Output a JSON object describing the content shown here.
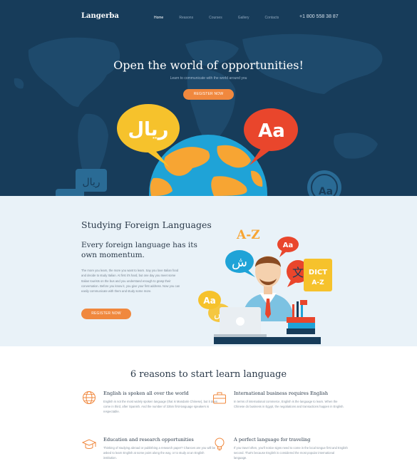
{
  "brand": {
    "name": "Langerba"
  },
  "nav": {
    "items": [
      {
        "label": "Home",
        "active": true
      },
      {
        "label": "Reasons",
        "active": false
      },
      {
        "label": "Courses",
        "active": false
      },
      {
        "label": "Gallery",
        "active": false
      },
      {
        "label": "Contacts",
        "active": false
      }
    ],
    "phone": "+1 800 558 38 87"
  },
  "hero": {
    "title": "Open the world of opportunities!",
    "subtitle": "Learn to communicate with the world around you",
    "button_label": "REGISTER NOW",
    "bubble_left_text": "ريال",
    "bubble_right_text": "Aa",
    "badge_left_text": "ريال",
    "badge_right_text": "Aa"
  },
  "study": {
    "title": "Studying Foreign Languages",
    "subtitle": "Every foreign language has its own momentum.",
    "body": "The more you learn, the more you want to learn. Say you love Italian food and decide to study Italian. At first it's hard, but one day you meet some Italian tourists on the bus and you understand enough to grasp their conversation. Before you know it, you give your first address. Now you can easily communicate with them and study some more.",
    "button_label": "REGISTER NOW",
    "art": {
      "az_label": "A-Z",
      "aa_small": "Aa",
      "arabic_small": "ش",
      "aa_left": "Aa",
      "arabic_left": "ش",
      "chinese_char": "文",
      "dict_label": "DICT",
      "dict_az": "A-Z"
    }
  },
  "reasons": {
    "title": "6 reasons to start learn language",
    "items": [
      {
        "icon": "globe-icon",
        "title": "English is spoken all over the world",
        "text": "English is not the most widely spoken language (that is Mandarin Chinese), but it does come in third, after Spanish. And the number of 335m first-language speakers is respectable."
      },
      {
        "icon": "briefcase-icon",
        "title": "International business requires English",
        "text": "In terms of international commerce, English is the language to learn. When the Chinese do business in Egypt, the negotiations and transactions happen in English."
      },
      {
        "icon": "graduation-cap-icon",
        "title": "Education and research opportunities",
        "text": "Thinking of studying abroad or publishing a research paper? Chances are you will be asked to learn English at some point along the way, or to study at an English institution."
      },
      {
        "icon": "lightbulb-icon",
        "title": "A perfect language for traveling",
        "text": "If you travel often, you'll notice signs need to come in the local tongue first and English second. That's because English is considered the most popular international language."
      }
    ]
  },
  "colors": {
    "hero_bg": "#173c5a",
    "accent_orange": "#f0883e",
    "study_bg": "#e9f2f8",
    "bubble_yellow": "#f6c22c",
    "bubble_red": "#e9462c",
    "globe_blue": "#1fa3d7",
    "globe_land": "#f7a533"
  }
}
